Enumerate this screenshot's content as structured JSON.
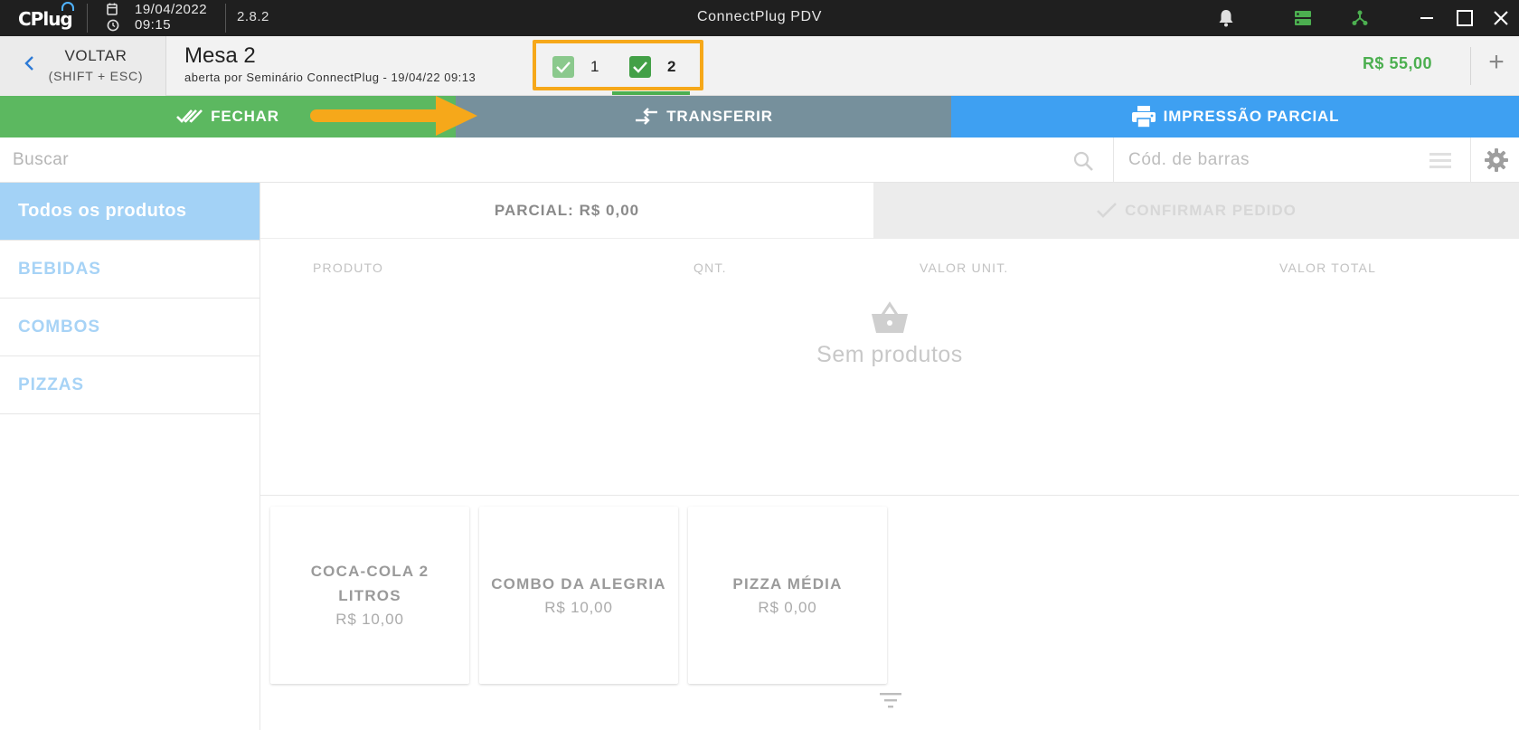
{
  "titlebar": {
    "logo": "CPlug",
    "date": "19/04/2022",
    "time": "09:15",
    "version": "2.8.2",
    "app_title": "ConnectPlug PDV"
  },
  "header": {
    "back_label": "VOLTAR",
    "back_shortcut": "(SHIFT + ESC)",
    "table_title": "Mesa 2",
    "table_subtitle": "aberta por Seminário ConnectPlug - 19/04/22 09:13",
    "tabs": [
      {
        "label": "1",
        "checked": true
      },
      {
        "label": "2",
        "checked": true
      }
    ],
    "total": "R$ 55,00",
    "add_label": "+"
  },
  "actions": {
    "close_label": "FECHAR",
    "transfer_label": "TRANSFERIR",
    "print_label": "IMPRESSÃO PARCIAL"
  },
  "search": {
    "placeholder": "Buscar",
    "barcode_placeholder": "Cód. de barras"
  },
  "sidebar": {
    "items": [
      {
        "label": "Todos os produtos",
        "active": true
      },
      {
        "label": "BEBIDAS"
      },
      {
        "label": "COMBOS"
      },
      {
        "label": "PIZZAS"
      }
    ]
  },
  "order": {
    "partial": "PARCIAL: R$ 0,00",
    "confirm_label": "CONFIRMAR PEDIDO",
    "columns": [
      "PRODUTO",
      "QNT.",
      "VALOR UNIT.",
      "VALOR TOTAL"
    ],
    "empty_text": "Sem produtos"
  },
  "products": [
    {
      "name": "COCA-COLA 2 LITROS",
      "price": "R$ 10,00"
    },
    {
      "name": "COMBO DA ALEGRIA",
      "price": "R$ 10,00"
    },
    {
      "name": "PIZZA MÉDIA",
      "price": "R$ 0,00"
    }
  ],
  "colors": {
    "green": "#5cb860",
    "slate": "#76909c",
    "blue": "#3ea0f2",
    "highlight": "#f6a81a",
    "total_green": "#4caf50"
  }
}
